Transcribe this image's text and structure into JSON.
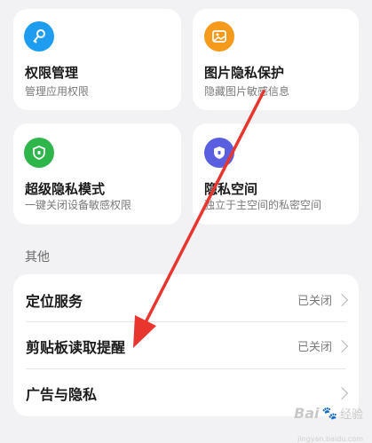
{
  "tiles": [
    {
      "title": "权限管理",
      "subtitle": "管理应用权限",
      "icon": "key-icon",
      "color": "#1e9df0"
    },
    {
      "title": "图片隐私保护",
      "subtitle": "隐藏图片敏感信息",
      "icon": "image-icon",
      "color": "#f59a1b"
    },
    {
      "title": "超级隐私模式",
      "subtitle": "一键关闭设备敏感权限",
      "icon": "shield-icon",
      "color": "#2fb64b"
    },
    {
      "title": "隐私空间",
      "subtitle": "独立于主空间的私密空间",
      "icon": "private-space-icon",
      "color": "#5a5fe0"
    }
  ],
  "section": {
    "label": "其他"
  },
  "list": [
    {
      "label": "定位服务",
      "value": "已关闭"
    },
    {
      "label": "剪贴板读取提醒",
      "value": "已关闭"
    },
    {
      "label": "广告与隐私",
      "value": ""
    }
  ],
  "watermark": {
    "logo": "Bai",
    "text": "经验",
    "url": "jingyan.baidu.com"
  },
  "colors": {
    "arrow": "#e8352e",
    "background": "#f2f2f4"
  }
}
